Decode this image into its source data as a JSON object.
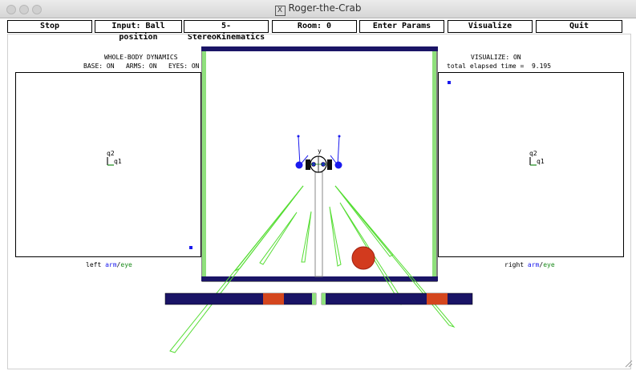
{
  "window": {
    "title": "Roger-the-Crab"
  },
  "toolbar": {
    "stop": "Stop",
    "input": "Input: Ball position",
    "mode": "5-StereoKinematics",
    "room": "Room: 0",
    "params": "Enter Params",
    "visualize": "Visualize",
    "quit": "Quit"
  },
  "left_panel": {
    "title": "WHOLE-BODY DYNAMICS",
    "status": "BASE: ON   ARMS: ON   EYES: ON",
    "q2": "q2",
    "q1": "q1",
    "caption": {
      "prefix": "left ",
      "arm": "arm",
      "sep": "/",
      "eye": "eye"
    }
  },
  "right_panel": {
    "title": "VISUALIZE: ON",
    "elapsed": "total elapsed time =  9.195",
    "q2": "q2",
    "q1": "q1",
    "caption": {
      "prefix": "right ",
      "arm": "arm",
      "sep": "/",
      "eye": "eye"
    }
  },
  "robot": {
    "y_label": "y"
  },
  "colors": {
    "wall": "#1a1466",
    "floor_green": "#8fe07c",
    "robot_blue": "#1a1aee",
    "ball": "#d23a1e",
    "eye_ray": "#55dd33",
    "image_bar": "#1a1466",
    "image_blob": "#d4461e"
  }
}
